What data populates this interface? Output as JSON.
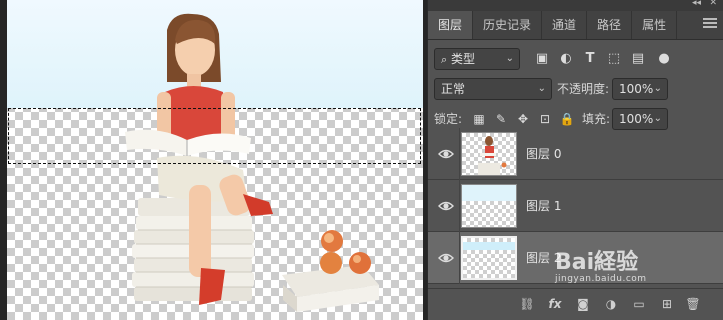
{
  "panel": {
    "tabs": [
      {
        "label": "图层",
        "active": true
      },
      {
        "label": "历史记录",
        "active": false
      },
      {
        "label": "通道",
        "active": false
      },
      {
        "label": "路径",
        "active": false
      },
      {
        "label": "属性",
        "active": false
      }
    ],
    "filter": {
      "label": "类型",
      "icon": "search-icon"
    },
    "blend_mode": "正常",
    "opacity_label": "不透明度:",
    "opacity_value": "100%",
    "lock_label": "锁定:",
    "fill_label": "填充:",
    "fill_value": "100%"
  },
  "layers": [
    {
      "name": "图层 0",
      "visible": true,
      "selected": false,
      "thumb": "girl-on-books"
    },
    {
      "name": "图层 1",
      "visible": true,
      "selected": false,
      "thumb": "light-blue-fill"
    },
    {
      "name": "图层 2",
      "visible": true,
      "selected": true,
      "thumb": "transparent-with-top-band"
    }
  ],
  "watermark": {
    "text": "Bai経验",
    "sub": "jingyan.baidu.com"
  },
  "colors": {
    "panel_bg": "#535353",
    "tab_bar": "#424242",
    "selected_layer": "#6a6a6a",
    "sky": "#e6f6fc"
  }
}
